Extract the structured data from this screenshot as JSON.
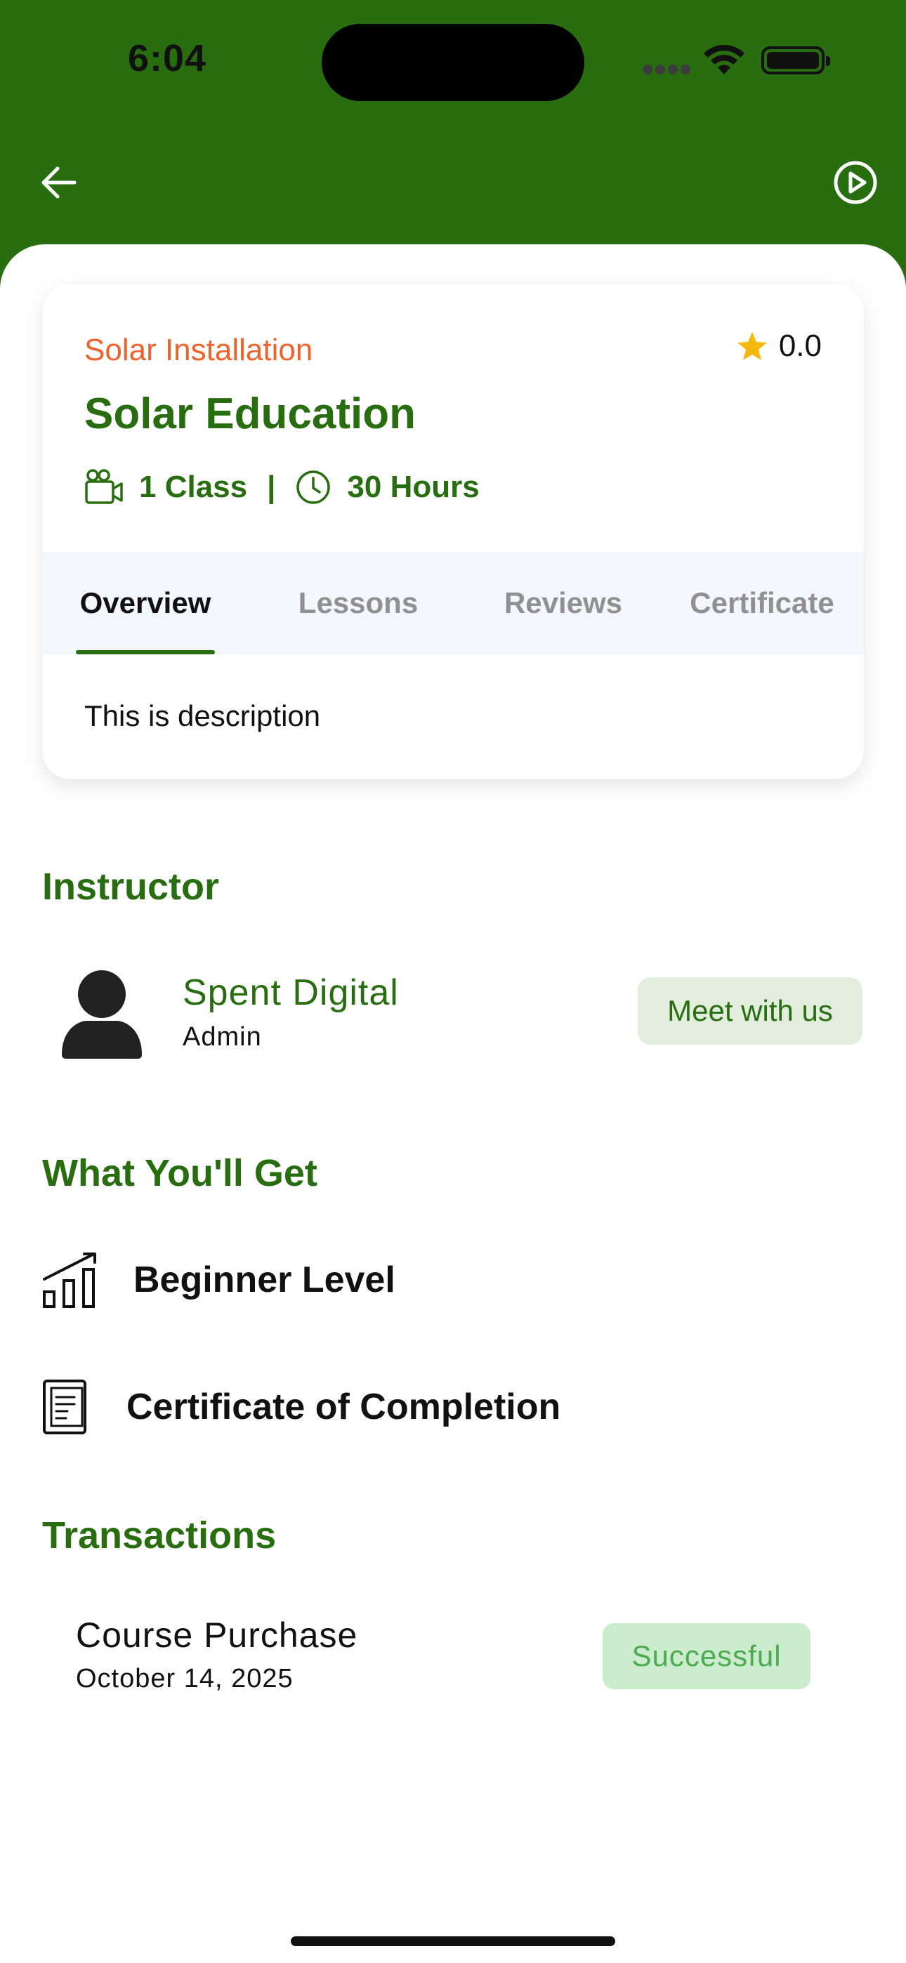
{
  "status_bar": {
    "time": "6:04"
  },
  "header": {
    "back_icon": "arrow-left-icon",
    "play_icon": "play-circle-icon",
    "background": "#286d0f"
  },
  "course": {
    "category": "Solar Installation",
    "rating": "0.0",
    "title": "Solar Education",
    "classes": "1 Class",
    "separator": "|",
    "hours": "30 Hours"
  },
  "tabs": [
    {
      "label": "Overview",
      "active": true
    },
    {
      "label": "Lessons",
      "active": false
    },
    {
      "label": "Reviews",
      "active": false
    },
    {
      "label": "Certificate",
      "active": false
    }
  ],
  "overview": {
    "description": "This is description"
  },
  "instructor": {
    "section_title": "Instructor",
    "name": "Spent Digital",
    "role": "Admin",
    "meet_label": "Meet with us"
  },
  "benefits": {
    "section_title": "What You'll Get",
    "items": [
      {
        "icon": "bar-chart-growth-icon",
        "label": "Beginner Level"
      },
      {
        "icon": "certificate-document-icon",
        "label": "Certificate of Completion"
      }
    ]
  },
  "transactions": {
    "section_title": "Transactions",
    "items": [
      {
        "title": "Course Purchase",
        "date": "October 14, 2025",
        "status": "Successful"
      }
    ]
  },
  "colors": {
    "brand_green": "#286d0f",
    "category_orange": "#f0622c",
    "star": "#f5b80f",
    "success_bg": "#cbeccc",
    "success_text": "#4caa50"
  }
}
